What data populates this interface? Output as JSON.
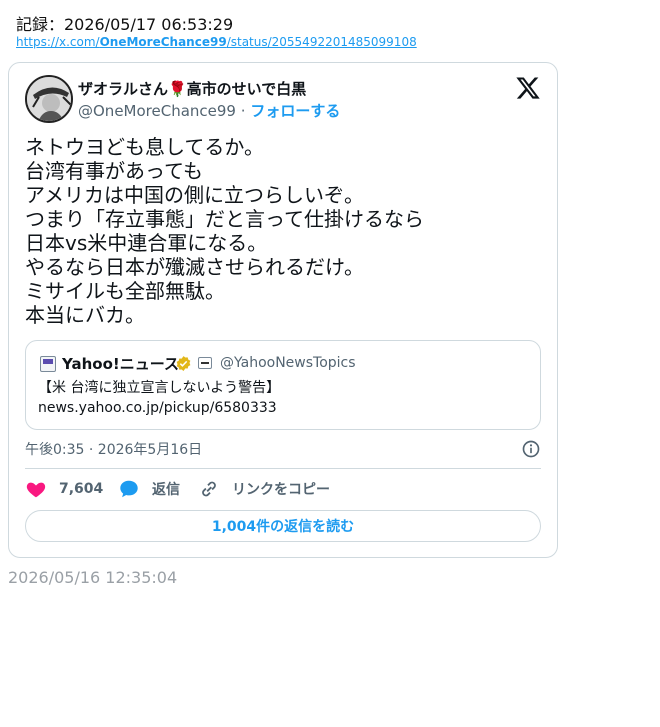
{
  "record": {
    "label": "記録：2026/05/17 06:53:29"
  },
  "source_link": {
    "prefix": "https://x.com/",
    "bold": "OneMoreChance99",
    "suffix": "/status/2055492201485099108"
  },
  "tweet": {
    "author_name": "ザオラルさん🌹高市のせいで白黒",
    "handle": "@OneMoreChance99",
    "separator": "·",
    "follow_label": "フォローする",
    "lines": [
      "ネトウヨども息してるか。",
      "台湾有事があっても",
      "アメリカは中国の側に立つらしいぞ。",
      "つまり「存立事態」だと言って仕掛けるなら",
      "日本vs米中連合軍になる。",
      "やるなら日本が殲滅させられるだけ。",
      "ミサイルも全部無駄。",
      "本当にバカ。"
    ],
    "quote": {
      "name": "Yahoo!ニュース",
      "handle": "@YahooNewsTopics",
      "line1": "【米 台湾に独立宣言しないよう警告】",
      "line2": "news.yahoo.co.jp/pickup/6580333"
    },
    "timestamp": "午後0:35 · 2026年5月16日",
    "likes": "7,604",
    "reply_label": "返信",
    "copy_link_label": "リンクをコピー",
    "read_replies_label": "1,004件の返信を読む"
  },
  "footer": {
    "time": "2026/05/16 12:35:04"
  },
  "icons": {
    "x_logo": "x-logo-icon",
    "like": "heart-icon",
    "reply": "chat-bubble-icon",
    "copy": "link-icon",
    "info": "info-icon",
    "verified": "verified-badge-icon"
  },
  "colors": {
    "accent": "#1d9bf0",
    "like": "#f91880",
    "verified": "#e2b719",
    "text": "#0f1419",
    "muted": "#536471"
  }
}
